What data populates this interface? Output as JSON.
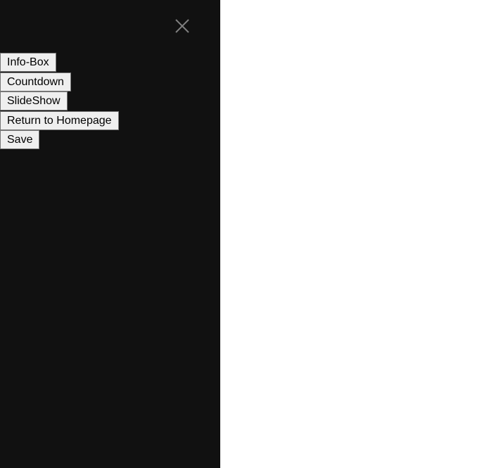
{
  "sidenav": {
    "background": "#111111",
    "close_icon": "close-icon",
    "close_color": "#818181",
    "buttons": [
      {
        "label": "Info-Box"
      },
      {
        "label": "Countdown"
      },
      {
        "label": "SlideShow"
      },
      {
        "label": "Return to Homepage"
      },
      {
        "label": "Save"
      }
    ]
  }
}
